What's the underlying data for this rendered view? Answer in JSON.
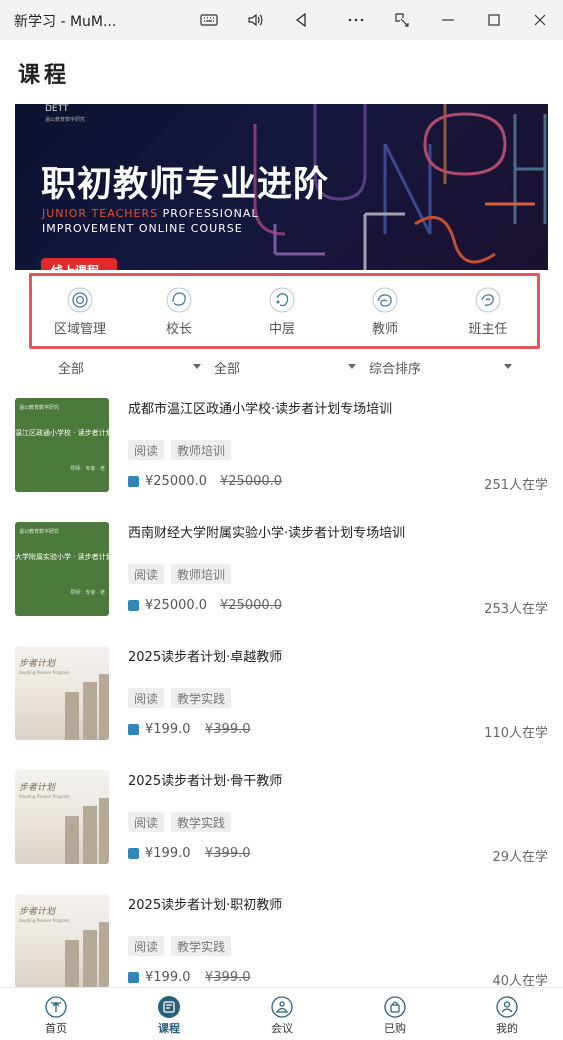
{
  "window": {
    "title": "新学习 - MuM...",
    "controls": [
      "keyboard-icon",
      "volume-icon",
      "back-icon",
      "more-icon",
      "snip-icon",
      "minimize-icon",
      "maximize-icon",
      "close-icon"
    ]
  },
  "header": {
    "title": "课程"
  },
  "banner": {
    "logo": "DETT",
    "logo_sub": "温公教育数字研究",
    "headline": "职初教师专业进阶",
    "english_line1_highlight": "JUNIOR TEACHERS",
    "english_line1_rest": " PROFESSIONAL",
    "english_line2": "IMPROVEMENT ONLINE COURSE",
    "tag": "线上课程"
  },
  "categories": [
    {
      "label": "区域管理",
      "icon": "region-icon"
    },
    {
      "label": "校长",
      "icon": "principal-icon"
    },
    {
      "label": "中层",
      "icon": "middle-level-icon"
    },
    {
      "label": "教师",
      "icon": "teacher-icon"
    },
    {
      "label": "班主任",
      "icon": "class-teacher-icon"
    }
  ],
  "filters": [
    {
      "label": "全部"
    },
    {
      "label": "全部"
    },
    {
      "label": "综合排序"
    }
  ],
  "courses": [
    {
      "title": "成都市温江区政通小学校·读步者计划专场培训",
      "tags": [
        "阅读",
        "教师培训"
      ],
      "price": "¥25000.0",
      "original": "¥25000.0",
      "learners": "251人在学",
      "thumb": "green",
      "thumb_text": "温江区政通小学校 · 读步者计划专",
      "thumb_small": "温公教育数字研究",
      "thumb_foot": "导师：专家 · 老"
    },
    {
      "title": "西南财经大学附属实验小学·读步者计划专场培训",
      "tags": [
        "阅读",
        "教师培训"
      ],
      "price": "¥25000.0",
      "original": "¥25000.0",
      "learners": "253人在学",
      "thumb": "green",
      "thumb_text": "大学附属实验小学 · 读步者计划专",
      "thumb_small": "温公教育数字研究",
      "thumb_foot": "导师：专家 · 老"
    },
    {
      "title": "2025读步者计划·卓越教师",
      "tags": [
        "阅读",
        "教学实践"
      ],
      "price": "¥199.0",
      "original": "¥399.0",
      "learners": "110人在学",
      "thumb": "lib",
      "thumb_text": "步者计划",
      "thumb_sub": "Reading Pioneer Program"
    },
    {
      "title": "2025读步者计划·骨干教师",
      "tags": [
        "阅读",
        "教学实践"
      ],
      "price": "¥199.0",
      "original": "¥399.0",
      "learners": "29人在学",
      "thumb": "lib",
      "thumb_text": "步者计划",
      "thumb_sub": "Reading Pioneer Program"
    },
    {
      "title": "2025读步者计划·职初教师",
      "tags": [
        "阅读",
        "教学实践"
      ],
      "price": "¥199.0",
      "original": "¥399.0",
      "learners": "40人在学",
      "thumb": "lib",
      "thumb_text": "步者计划",
      "thumb_sub": "Reading Pioneer Program"
    }
  ],
  "bottom_nav": [
    {
      "label": "首页",
      "icon": "home-icon",
      "active": false
    },
    {
      "label": "课程",
      "icon": "course-icon",
      "active": true
    },
    {
      "label": "会议",
      "icon": "meeting-icon",
      "active": false
    },
    {
      "label": "已购",
      "icon": "purchased-icon",
      "active": false
    },
    {
      "label": "我的",
      "icon": "profile-icon",
      "active": false
    }
  ],
  "colors": {
    "accent": "#2a5f7a",
    "highlight_border": "#e4565b",
    "banner_tag": "#e02a2a"
  }
}
